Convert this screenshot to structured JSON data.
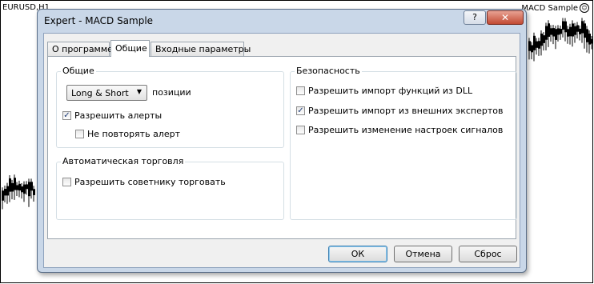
{
  "chart": {
    "symbol_label": "EURUSD,H1",
    "expert_label": "MACD Sample",
    "expert_status_icon": "smiley-icon"
  },
  "dialog": {
    "title": "Expert - MACD Sample",
    "help_icon": "?",
    "close_icon": "✕",
    "tabs": [
      {
        "label": "О программе"
      },
      {
        "label": "Общие"
      },
      {
        "label": "Входные параметры"
      }
    ],
    "general": {
      "title": "Общие",
      "positions_value": "Long & Short",
      "positions_suffix": "позиции",
      "allow_alerts": {
        "label": "Разрешить алерты",
        "checked": true
      },
      "no_repeat_alert": {
        "label": "Не повторять алерт",
        "checked": false
      }
    },
    "autotrading": {
      "title": "Автоматическая торговля",
      "allow_trading": {
        "label": "Разрешить советнику торговать",
        "checked": false
      }
    },
    "security": {
      "title": "Безопасность",
      "allow_dll": {
        "label": "Разрешить импорт функций из DLL",
        "checked": false
      },
      "allow_external": {
        "label": "Разрешить импорт из внешних экспертов",
        "checked": true
      },
      "allow_signal_change": {
        "label": "Разрешить изменение настроек сигналов",
        "checked": false
      }
    },
    "buttons": {
      "ok": "ОК",
      "cancel": "Отмена",
      "reset": "Сброс"
    }
  }
}
